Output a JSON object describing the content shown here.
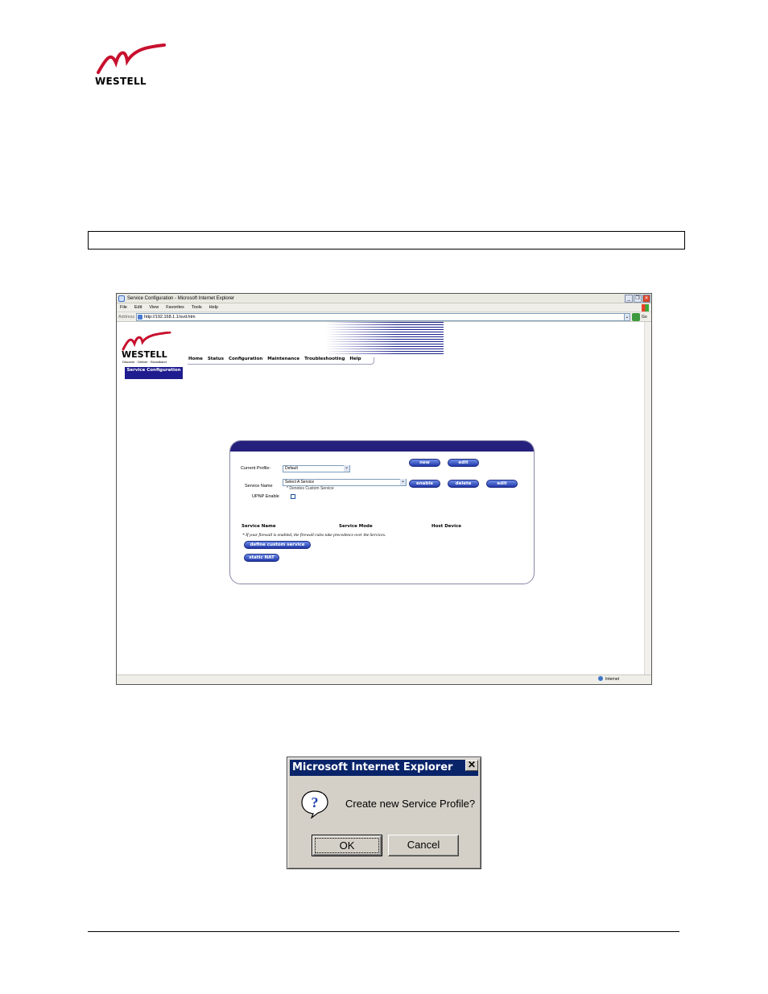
{
  "page": {
    "brand": "WESTELL",
    "note_box_text": ""
  },
  "browser": {
    "title": "Service Configuration - Microsoft Internet Explorer",
    "menu": [
      "File",
      "Edit",
      "View",
      "Favorites",
      "Tools",
      "Help"
    ],
    "address_label": "Address",
    "address_url": "http://192.168.1.1/svd.htm",
    "go_label": "Go",
    "status_zone": "Internet"
  },
  "site": {
    "brand": "WESTELL",
    "tagline": "Discover · Deliver · Broadband",
    "nav": [
      "Home",
      "Status",
      "Configuration",
      "Maintenance",
      "Troubleshooting",
      "Help"
    ],
    "sidebar_item": "Service Configuration"
  },
  "service_panel": {
    "current_profile_label": "Current Profile:",
    "current_profile_value": "Default",
    "new_btn": "new",
    "edit_btn": "edit",
    "service_name_label": "Service Name",
    "service_select_value": "Select A Service",
    "service_select_hint": "* Denotes Custom Service",
    "enable_btn": "enable",
    "delete_btn": "delete",
    "edit2_btn": "edit",
    "upnp_label": "UPNP Enable",
    "upnp_checked": false,
    "columns": [
      "Service Name",
      "Service Mode",
      "Host Device"
    ],
    "firewall_note": "* If your firewall is enabled, the firewall rules take precedence over the Services.",
    "define_custom_btn": "define custom service",
    "static_nat_btn": "static NAT"
  },
  "dialog": {
    "title": "Microsoft Internet Explorer",
    "close": "✕",
    "icon": "question-icon",
    "message": "Create new Service Profile?",
    "ok": "OK",
    "cancel": "Cancel"
  },
  "colors": {
    "westell_red": "#c8102e",
    "nav_blue": "#1e1c8e",
    "dialog_title": "#0a246a",
    "dialog_face": "#d4d0c8"
  }
}
